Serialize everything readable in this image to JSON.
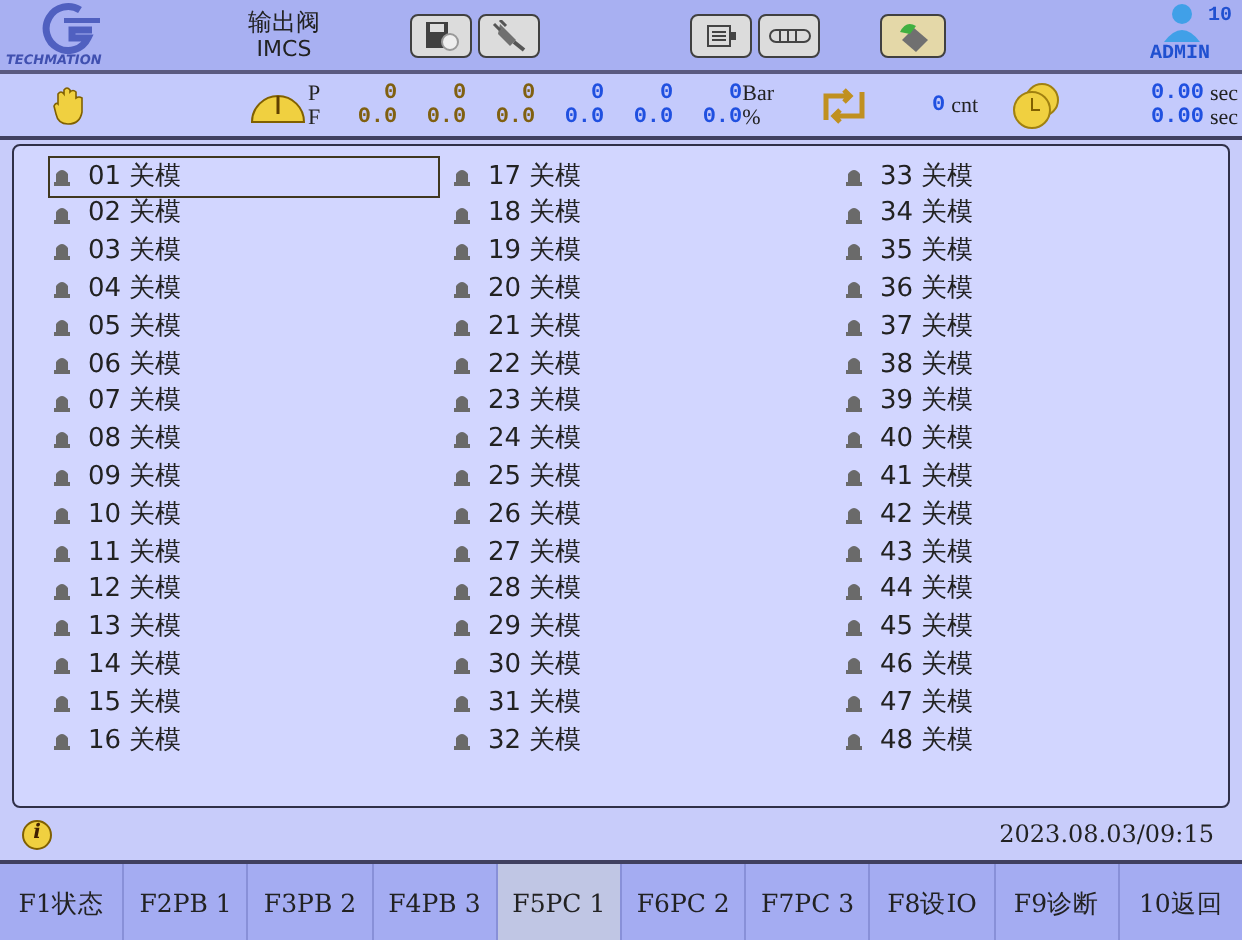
{
  "header": {
    "logo_text": "TECHMATION",
    "title": "输出阀",
    "subtitle": "IMCS",
    "user": "ADMIN",
    "user_level": "10"
  },
  "status": {
    "p_label": "P",
    "f_label": "F",
    "p_unit": "Bar",
    "f_unit": "%",
    "columns": [
      {
        "p": "0",
        "f": "0.0",
        "color": "#806010"
      },
      {
        "p": "0",
        "f": "0.0",
        "color": "#806010"
      },
      {
        "p": "0",
        "f": "0.0",
        "color": "#806010"
      },
      {
        "p": "0",
        "f": "0.0",
        "color": "#2050e0"
      },
      {
        "p": "0",
        "f": "0.0",
        "color": "#2050e0"
      },
      {
        "p": "0",
        "f": "0.0",
        "color": "#2050e0"
      }
    ],
    "count": "0",
    "count_unit": "cnt",
    "time1": "0.00",
    "time2": "0.00",
    "time_unit1": "sec",
    "time_unit2": "sec"
  },
  "outputs": [
    {
      "num": "01",
      "label": "关模",
      "on": false,
      "selected": true
    },
    {
      "num": "02",
      "label": "关模",
      "on": false,
      "selected": false
    },
    {
      "num": "03",
      "label": "关模",
      "on": false,
      "selected": false
    },
    {
      "num": "04",
      "label": "关模",
      "on": false,
      "selected": false
    },
    {
      "num": "05",
      "label": "关模",
      "on": false,
      "selected": false
    },
    {
      "num": "06",
      "label": "关模",
      "on": false,
      "selected": false
    },
    {
      "num": "07",
      "label": "关模",
      "on": false,
      "selected": false
    },
    {
      "num": "08",
      "label": "关模",
      "on": false,
      "selected": false
    },
    {
      "num": "09",
      "label": "关模",
      "on": false,
      "selected": false
    },
    {
      "num": "10",
      "label": "关模",
      "on": false,
      "selected": false
    },
    {
      "num": "11",
      "label": "关模",
      "on": false,
      "selected": false
    },
    {
      "num": "12",
      "label": "关模",
      "on": false,
      "selected": false
    },
    {
      "num": "13",
      "label": "关模",
      "on": false,
      "selected": false
    },
    {
      "num": "14",
      "label": "关模",
      "on": false,
      "selected": false
    },
    {
      "num": "15",
      "label": "关模",
      "on": false,
      "selected": false
    },
    {
      "num": "16",
      "label": "关模",
      "on": false,
      "selected": false
    },
    {
      "num": "17",
      "label": "关模",
      "on": false,
      "selected": false
    },
    {
      "num": "18",
      "label": "关模",
      "on": false,
      "selected": false
    },
    {
      "num": "19",
      "label": "关模",
      "on": false,
      "selected": false
    },
    {
      "num": "20",
      "label": "关模",
      "on": false,
      "selected": false
    },
    {
      "num": "21",
      "label": "关模",
      "on": false,
      "selected": false
    },
    {
      "num": "22",
      "label": "关模",
      "on": false,
      "selected": false
    },
    {
      "num": "23",
      "label": "关模",
      "on": false,
      "selected": false
    },
    {
      "num": "24",
      "label": "关模",
      "on": false,
      "selected": false
    },
    {
      "num": "25",
      "label": "关模",
      "on": false,
      "selected": false
    },
    {
      "num": "26",
      "label": "关模",
      "on": false,
      "selected": false
    },
    {
      "num": "27",
      "label": "关模",
      "on": false,
      "selected": false
    },
    {
      "num": "28",
      "label": "关模",
      "on": false,
      "selected": false
    },
    {
      "num": "29",
      "label": "关模",
      "on": false,
      "selected": false
    },
    {
      "num": "30",
      "label": "关模",
      "on": false,
      "selected": false
    },
    {
      "num": "31",
      "label": "关模",
      "on": false,
      "selected": false
    },
    {
      "num": "32",
      "label": "关模",
      "on": false,
      "selected": false
    },
    {
      "num": "33",
      "label": "关模",
      "on": false,
      "selected": false
    },
    {
      "num": "34",
      "label": "关模",
      "on": false,
      "selected": false
    },
    {
      "num": "35",
      "label": "关模",
      "on": false,
      "selected": false
    },
    {
      "num": "36",
      "label": "关模",
      "on": false,
      "selected": false
    },
    {
      "num": "37",
      "label": "关模",
      "on": false,
      "selected": false
    },
    {
      "num": "38",
      "label": "关模",
      "on": false,
      "selected": false
    },
    {
      "num": "39",
      "label": "关模",
      "on": false,
      "selected": false
    },
    {
      "num": "40",
      "label": "关模",
      "on": false,
      "selected": false
    },
    {
      "num": "41",
      "label": "关模",
      "on": false,
      "selected": false
    },
    {
      "num": "42",
      "label": "关模",
      "on": false,
      "selected": false
    },
    {
      "num": "43",
      "label": "关模",
      "on": false,
      "selected": false
    },
    {
      "num": "44",
      "label": "关模",
      "on": false,
      "selected": false
    },
    {
      "num": "45",
      "label": "关模",
      "on": false,
      "selected": false
    },
    {
      "num": "46",
      "label": "关模",
      "on": false,
      "selected": false
    },
    {
      "num": "47",
      "label": "关模",
      "on": false,
      "selected": false
    },
    {
      "num": "48",
      "label": "关模",
      "on": false,
      "selected": false
    }
  ],
  "info_bar": {
    "icon": "i",
    "datetime": "2023.08.03/09:15"
  },
  "function_keys": [
    {
      "label": "F1状态",
      "selected": false
    },
    {
      "label": "F2PB 1",
      "selected": false
    },
    {
      "label": "F3PB 2",
      "selected": false
    },
    {
      "label": "F4PB 3",
      "selected": false
    },
    {
      "label": "F5PC 1",
      "selected": true
    },
    {
      "label": "F6PC 2",
      "selected": false
    },
    {
      "label": "F7PC 3",
      "selected": false
    },
    {
      "label": "F8设IO",
      "selected": false
    },
    {
      "label": "F9诊断",
      "selected": false
    },
    {
      "label": "10返回",
      "selected": false
    }
  ]
}
